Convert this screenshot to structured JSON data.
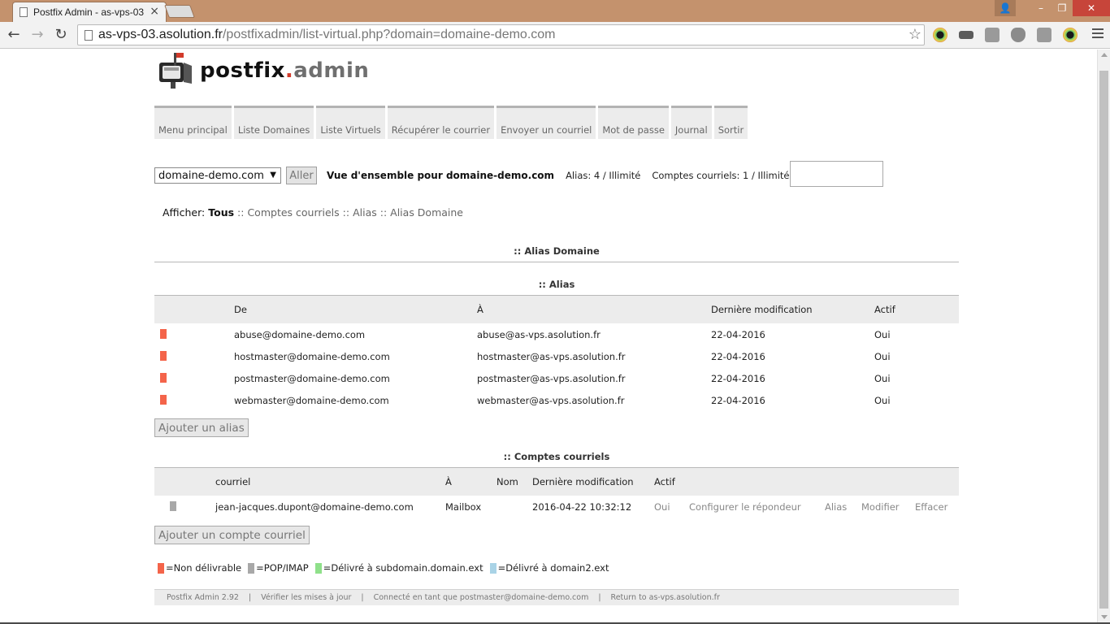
{
  "browser": {
    "tab_title": "Postfix Admin - as-vps-03",
    "url_host": "as-vps-03.asolution.fr",
    "url_path": "/postfixadmin/list-virtual.php?domain=domaine-demo.com"
  },
  "logo": {
    "part1": "postfix",
    "dot": ".",
    "part2": "admin"
  },
  "menu": [
    {
      "label": "Menu principal"
    },
    {
      "label": "Liste Domaines"
    },
    {
      "label": "Liste Virtuels"
    },
    {
      "label": "Récupérer le courrier"
    },
    {
      "label": "Envoyer un courriel"
    },
    {
      "label": "Mot de passe"
    },
    {
      "label": "Journal"
    },
    {
      "label": "Sortir"
    }
  ],
  "domainbar": {
    "selected_domain": "domaine-demo.com",
    "go_label": "Aller",
    "overview": "Vue d'ensemble pour domaine-demo.com",
    "alias_stat": "Alias: 4 / Illimité",
    "mailbox_stat": "Comptes courriels: 1 / Illimité"
  },
  "filters": {
    "label": "Afficher:",
    "all": "Tous",
    "sep": "::",
    "mailboxes": "Comptes courriels",
    "aliases": "Alias",
    "alias_domains": "Alias Domaine"
  },
  "sections": {
    "alias_domain_title": ":: Alias Domaine",
    "alias_title": ":: Alias",
    "mailbox_title": ":: Comptes courriels"
  },
  "alias_table": {
    "headers": {
      "from": "De",
      "to": "À",
      "modified": "Dernière modification",
      "active": "Actif"
    },
    "rows": [
      {
        "from": "abuse@domaine-demo.com",
        "to": "abuse@as-vps.asolution.fr",
        "modified": "22-04-2016",
        "active": "Oui"
      },
      {
        "from": "hostmaster@domaine-demo.com",
        "to": "hostmaster@as-vps.asolution.fr",
        "modified": "22-04-2016",
        "active": "Oui"
      },
      {
        "from": "postmaster@domaine-demo.com",
        "to": "postmaster@as-vps.asolution.fr",
        "modified": "22-04-2016",
        "active": "Oui"
      },
      {
        "from": "webmaster@domaine-demo.com",
        "to": "webmaster@as-vps.asolution.fr",
        "modified": "22-04-2016",
        "active": "Oui"
      }
    ],
    "add_label": "Ajouter un alias"
  },
  "mailbox_table": {
    "headers": {
      "email": "courriel",
      "to": "À",
      "name": "Nom",
      "modified": "Dernière modification",
      "active": "Actif"
    },
    "rows": [
      {
        "email": "jean-jacques.dupont@domaine-demo.com",
        "to": "Mailbox",
        "name": "",
        "modified": "2016-04-22 10:32:12",
        "active": "Oui",
        "vacation": "Configurer le répondeur",
        "alias": "Alias",
        "edit": "Modifier",
        "delete": "Effacer"
      }
    ],
    "add_label": "Ajouter un compte courriel"
  },
  "legend": [
    {
      "label": "=Non délivrable",
      "color": "#f4644a"
    },
    {
      "label": "=POP/IMAP",
      "color": "#a8a8a8"
    },
    {
      "label": "=Délivré à subdomain.domain.ext",
      "color": "#8fe08a"
    },
    {
      "label": "=Délivré à domain2.ext",
      "color": "#a9d3e6"
    }
  ],
  "footer": {
    "version": "Postfix Admin 2.92",
    "check_updates": "Vérifier les mises à jour",
    "logged_in": "Connecté en tant que postmaster@domaine-demo.com",
    "return": "Return to as-vps.asolution.fr",
    "sep": "|"
  }
}
